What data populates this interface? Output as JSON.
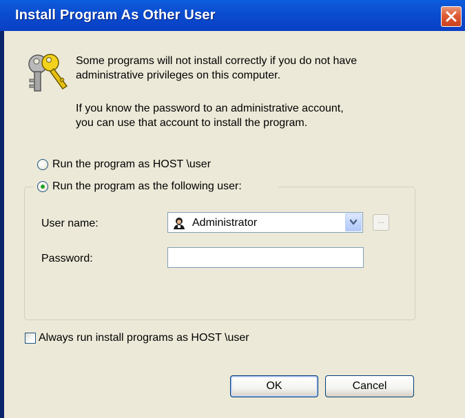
{
  "window": {
    "title": "Install Program As Other User"
  },
  "info": {
    "line1": "Some programs will not install correctly if you do not have",
    "line2": "administrative privileges on this computer.",
    "line3": "If you know the password to an administrative account,",
    "line4": "you can use that account to install the program."
  },
  "options": {
    "current_user_label": "Run the program as HOST \\user",
    "following_user_label": "Run the program as the following user:",
    "selected": "following_user"
  },
  "form": {
    "username_label": "User name:",
    "username_value": "Administrator",
    "password_label": "Password:",
    "password_value": "",
    "browse_label": "..."
  },
  "always_run": {
    "label": "Always run install programs as HOST \\user",
    "checked": false
  },
  "buttons": {
    "ok": "OK",
    "cancel": "Cancel"
  },
  "colors": {
    "titlebar": "#0a4cd0",
    "dialog_bg": "#ece9d8",
    "close_button": "#e05b34",
    "radio_dot": "#21a121"
  }
}
